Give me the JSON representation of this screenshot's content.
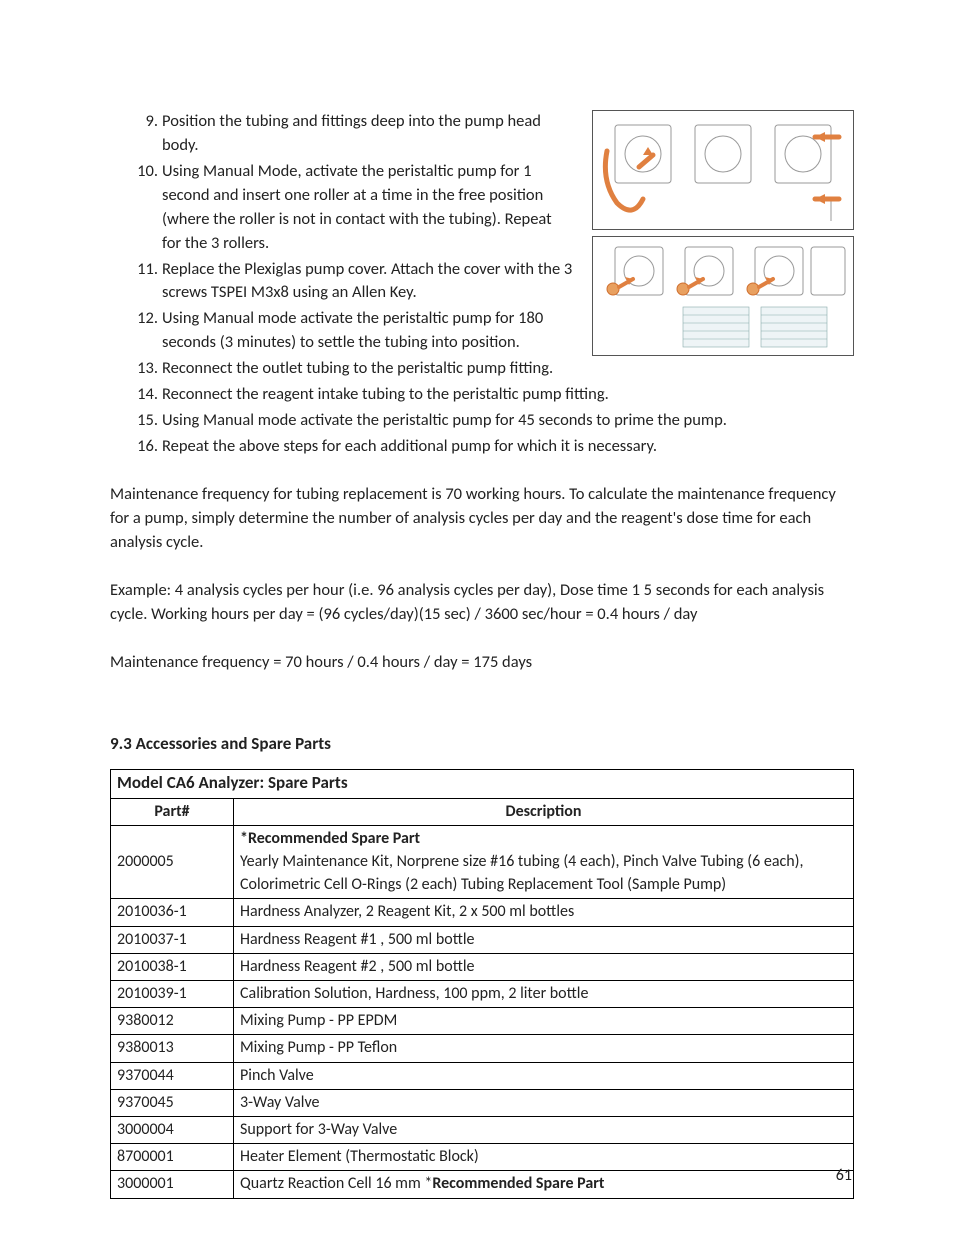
{
  "steps_a": [
    "Position the tubing and fittings deep into the pump head body.",
    "Using Manual Mode, activate the peristaltic pump for 1 second and insert one roller at a time in the free position (where the roller is not in contact with the tubing). Repeat for the 3 rollers.",
    "Replace the Plexiglas pump cover.  Attach the cover with the 3 screws TSPEI M3x8 using an Allen Key.",
    "Using Manual mode activate the peristaltic pump for 180 seconds (3 minutes) to settle the tubing into position."
  ],
  "steps_b": [
    "Reconnect the outlet tubing to the peristaltic pump fitting.",
    "Reconnect the reagent intake tubing to the peristaltic pump fitting.",
    "Using Manual mode activate the peristaltic pump for 45 seconds to prime the pump.",
    "Repeat the above steps for each additional pump for which it is necessary."
  ],
  "paragraphs": {
    "p1": "Maintenance frequency for tubing replacement is 70 working hours. To calculate the maintenance frequency for a pump, simply determine the number of analysis cycles per day and the reagent's dose time for each analysis cycle.",
    "p2": "Example: 4 analysis cycles per hour (i.e. 96 analysis cycles per day), Dose time 1 5 seconds for each analysis cycle. Working hours per day = (96 cycles/day)(15 sec) / 3600 sec/hour = 0.4 hours / day",
    "p3": "Maintenance frequency = 70 hours / 0.4 hours / day = 175 days"
  },
  "section_heading": "9.3 Accessories and Spare Parts",
  "table": {
    "title": "Model CA6 Analyzer: Spare Parts",
    "headers": {
      "part": "Part#",
      "desc": "Description"
    },
    "first_row": {
      "part": "2000005",
      "desc_bold": "*Recommended Spare Part",
      "desc_rest": "Yearly Maintenance Kit, Norprene size #16 tubing (4 each), Pinch Valve Tubing (6 each), Colorimetric Cell O-Rings (2 each) Tubing Replacement Tool (Sample Pump)"
    },
    "rows": [
      {
        "part": "2010036-1",
        "desc": "Hardness Analyzer, 2 Reagent Kit, 2 x 500 ml bottles"
      },
      {
        "part": "2010037-1",
        "desc": "Hardness Reagent #1  , 500 ml bottle"
      },
      {
        "part": "2010038-1",
        "desc": "Hardness Reagent #2  , 500 ml bottle"
      },
      {
        "part": "2010039-1",
        "desc": "Calibration Solution, Hardness, 100 ppm, 2 liter bottle"
      },
      {
        "part": "9380012",
        "desc": "Mixing Pump - PP EPDM"
      },
      {
        "part": "9380013",
        "desc": "Mixing Pump - PP Teflon"
      },
      {
        "part": "9370044",
        "desc": "Pinch Valve"
      },
      {
        "part": "9370045",
        "desc": "3-Way Valve"
      },
      {
        "part": "3000004",
        "desc": "Support for 3-Way Valve"
      },
      {
        "part": "8700001",
        "desc": "Heater Element (Thermostatic Block)"
      }
    ],
    "last_row": {
      "part": "3000001",
      "desc_plain": "Quartz Reaction Cell 16 mm *",
      "desc_bold": "Recommended Spare Part"
    }
  },
  "page_number": "61"
}
